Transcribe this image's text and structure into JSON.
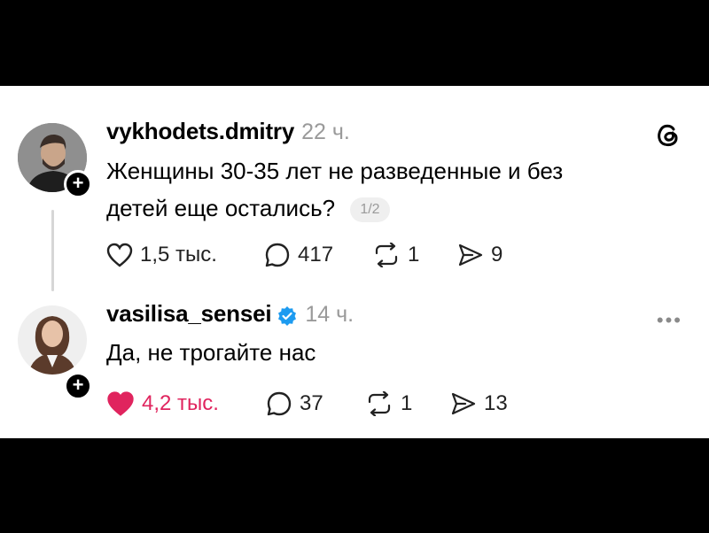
{
  "posts": [
    {
      "username": "vykhodets.dmitry",
      "time": "22 ч.",
      "text_line1": "Женщины 30-35 лет не разведенные и без",
      "text_line2": "детей еще остались?",
      "page_badge": "1/2",
      "likes": "1,5 тыс.",
      "comments": "417",
      "reposts": "1",
      "shares": "9",
      "liked": false
    },
    {
      "username": "vasilisa_sensei",
      "time": "14 ч.",
      "verified": true,
      "text": "Да, не трогайте нас",
      "likes": "4,2 тыс.",
      "comments": "37",
      "reposts": "1",
      "shares": "13",
      "liked": true
    }
  ],
  "icons": {
    "threads_logo": "threads-logo-icon",
    "more": "more-options-icon",
    "like": "heart-icon",
    "comment": "comment-icon",
    "repost": "repost-icon",
    "share": "share-icon",
    "follow": "plus-icon",
    "verified": "verified-badge-icon"
  },
  "colors": {
    "like_active": "#e0245e",
    "verified": "#1d9bf0",
    "muted": "#9a9a9a"
  }
}
